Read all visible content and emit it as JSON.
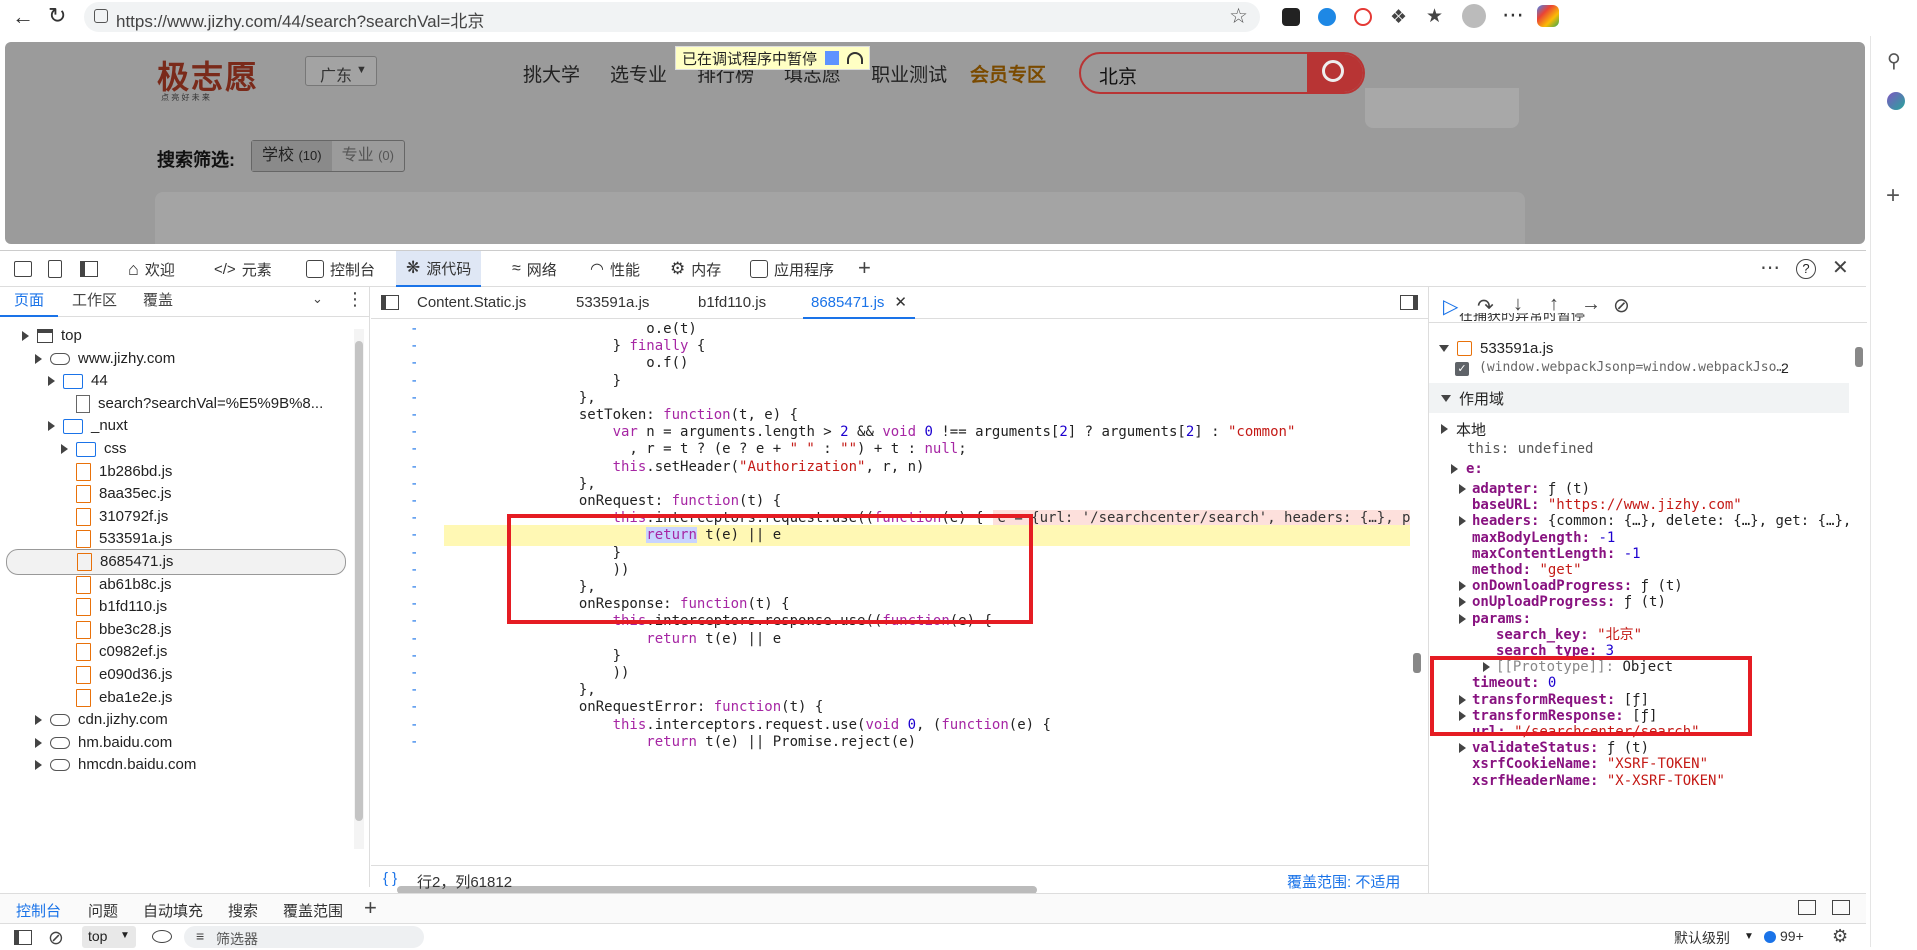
{
  "browser": {
    "url": "https://www.jizhy.com/44/search?searchVal=北京"
  },
  "site": {
    "logo_text": "极志愿",
    "logo_sub": "点 亮 好 未 来",
    "region": "广东",
    "nav": [
      "挑大学",
      "选专业",
      "排行榜",
      "填志愿",
      "职业测试"
    ],
    "vip": "会员专区",
    "search_value": "北京",
    "paused_banner": "已在调试程序中暂停",
    "filter_label": "搜索筛选:",
    "filter_school": "学校",
    "filter_school_count": "(10)",
    "filter_major": "专业",
    "filter_major_count": "(0)"
  },
  "devtools": {
    "tabs": [
      "欢迎",
      "元素",
      "控制台",
      "源代码",
      "网络",
      "性能",
      "内存",
      "应用程序"
    ],
    "active_tab": "源代码",
    "nav_tabs": [
      "页面",
      "工作区",
      "覆盖"
    ],
    "file_tabs": [
      "Content.Static.js",
      "533591a.js",
      "b1fd110.js",
      "8685471.js"
    ],
    "active_file": "8685471.js",
    "tree": [
      {
        "label": "top",
        "type": "frame",
        "depth": 0
      },
      {
        "label": "www.jizhy.com",
        "type": "cloud",
        "depth": 1
      },
      {
        "label": "44",
        "type": "folder",
        "depth": 2
      },
      {
        "label": "search?searchVal=%E5%9B%8...",
        "type": "page",
        "depth": 3
      },
      {
        "label": "_nuxt",
        "type": "folder",
        "depth": 2
      },
      {
        "label": "css",
        "type": "folder",
        "depth": 3
      },
      {
        "label": "1b286bd.js",
        "type": "file",
        "depth": 3
      },
      {
        "label": "8aa35ec.js",
        "type": "file",
        "depth": 3
      },
      {
        "label": "310792f.js",
        "type": "file",
        "depth": 3
      },
      {
        "label": "533591a.js",
        "type": "file",
        "depth": 3
      },
      {
        "label": "8685471.js",
        "type": "file",
        "depth": 3,
        "selected": true
      },
      {
        "label": "ab61b8c.js",
        "type": "file",
        "depth": 3
      },
      {
        "label": "b1fd110.js",
        "type": "file",
        "depth": 3
      },
      {
        "label": "bbe3c28.js",
        "type": "file",
        "depth": 3
      },
      {
        "label": "c0982ef.js",
        "type": "file",
        "depth": 3
      },
      {
        "label": "e090d36.js",
        "type": "file",
        "depth": 3
      },
      {
        "label": "eba1e2e.js",
        "type": "file",
        "depth": 3
      },
      {
        "label": "cdn.jizhy.com",
        "type": "cloud",
        "depth": 1
      },
      {
        "label": "hm.baidu.com",
        "type": "cloud",
        "depth": 1
      },
      {
        "label": "hmcdn.baidu.com",
        "type": "cloud",
        "depth": 1
      }
    ],
    "status_position": "行2，列61812",
    "status_coverage": "覆盖范围: 不适用",
    "inline_value": "e = {url: '/searchcenter/search', headers: {…}, params:",
    "callstack_file": "533591a.js",
    "callstack_frame": "(window.webpackJsonp=window.webpackJso…",
    "callstack_line": "2",
    "callstack_top": "在捕获的异常时暂停",
    "scope_header": "作用域",
    "scope_local": "本地",
    "scope_this": "this: undefined",
    "scope_e": "e:",
    "drawer_tabs": [
      "控制台",
      "问题",
      "自动填充",
      "搜索",
      "覆盖范围"
    ],
    "console_context": "top",
    "console_filter": "筛选器",
    "console_level": "默认级别",
    "console_count": "99+"
  },
  "code": [
    "                        o.e(t)",
    "                    } finally {",
    "                        o.f()",
    "                    }",
    "                },",
    "                setToken: function(t, e) {",
    "                    var n = arguments.length > 2 && void 0 !== arguments[2] ? arguments[2] : \"common\"",
    "                      , r = t ? (e ? e + \" \" : \"\") + t : null;",
    "                    this.setHeader(\"Authorization\", r, n)",
    "                },",
    "                onRequest: function(t) {",
    "                    this.interceptors.request.use((function(e) {",
    "                        return t(e) || e",
    "                    }",
    "                    ))",
    "                },",
    "                onResponse: function(t) {",
    "                    this.interceptors.response.use((function(e) {",
    "                        return t(e) || e",
    "                    }",
    "                    ))",
    "                },",
    "                onRequestError: function(t) {",
    "                    this.interceptors.request.use(void 0, (function(e) {",
    "                        return t(e) || Promise.reject(e)"
  ],
  "scope": [
    {
      "k": "adapter",
      "v": "ƒ (t)",
      "t": "fn",
      "arrow": true
    },
    {
      "k": "baseURL",
      "v": "\"https://www.jizhy.com\"",
      "t": "s"
    },
    {
      "k": "headers",
      "v": "{common: {…}, delete: {…}, get: {…},",
      "t": "o",
      "arrow": true
    },
    {
      "k": "maxBodyLength",
      "v": "-1",
      "t": "n"
    },
    {
      "k": "maxContentLength",
      "v": "-1",
      "t": "n"
    },
    {
      "k": "method",
      "v": "\"get\"",
      "t": "s"
    },
    {
      "k": "onDownloadProgress",
      "v": "ƒ (t)",
      "t": "fn",
      "arrow": true
    },
    {
      "k": "onUploadProgress",
      "v": "ƒ (t)",
      "t": "fn",
      "arrow": true
    },
    {
      "k": "params",
      "v": "",
      "t": "o",
      "arrow": true
    },
    {
      "k": "search_key",
      "v": "\"北京\"",
      "t": "s",
      "indent": true
    },
    {
      "k": "search_type",
      "v": "3",
      "t": "n",
      "indent": true
    },
    {
      "k": "[[Prototype]]",
      "v": "Object",
      "t": "o",
      "indent": true,
      "arrow": true
    },
    {
      "k": "timeout",
      "v": "0",
      "t": "n"
    },
    {
      "k": "transformRequest",
      "v": "[ƒ]",
      "t": "o",
      "arrow": true
    },
    {
      "k": "transformResponse",
      "v": "[ƒ]",
      "t": "o",
      "arrow": true
    },
    {
      "k": "url",
      "v": "\"/searchcenter/search\"",
      "t": "s"
    },
    {
      "k": "validateStatus",
      "v": "ƒ (t)",
      "t": "fn",
      "arrow": true
    },
    {
      "k": "xsrfCookieName",
      "v": "\"XSRF-TOKEN\"",
      "t": "s"
    },
    {
      "k": "xsrfHeaderName",
      "v": "\"X-XSRF-TOKEN\"",
      "t": "s"
    }
  ]
}
